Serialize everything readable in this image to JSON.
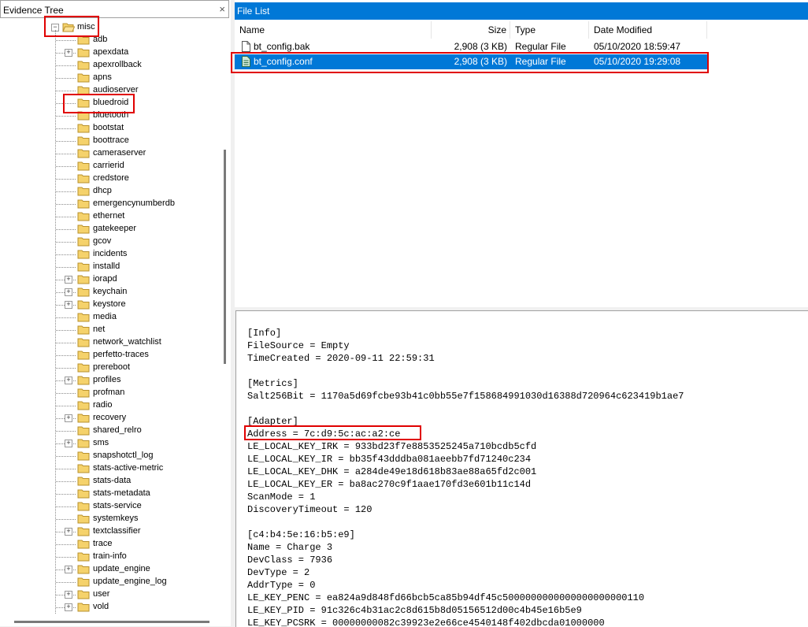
{
  "tree": {
    "title": "Evidence Tree",
    "close": "×",
    "root": "misc",
    "items": [
      {
        "label": "adb",
        "expandable": false
      },
      {
        "label": "apexdata",
        "expandable": true
      },
      {
        "label": "apexrollback",
        "expandable": false
      },
      {
        "label": "apns",
        "expandable": false
      },
      {
        "label": "audioserver",
        "expandable": false
      },
      {
        "label": "bluedroid",
        "expandable": false
      },
      {
        "label": "bluetooth",
        "expandable": false
      },
      {
        "label": "bootstat",
        "expandable": false
      },
      {
        "label": "boottrace",
        "expandable": false
      },
      {
        "label": "cameraserver",
        "expandable": false
      },
      {
        "label": "carrierid",
        "expandable": false
      },
      {
        "label": "credstore",
        "expandable": false
      },
      {
        "label": "dhcp",
        "expandable": false
      },
      {
        "label": "emergencynumberdb",
        "expandable": false
      },
      {
        "label": "ethernet",
        "expandable": false
      },
      {
        "label": "gatekeeper",
        "expandable": false
      },
      {
        "label": "gcov",
        "expandable": false
      },
      {
        "label": "incidents",
        "expandable": false
      },
      {
        "label": "installd",
        "expandable": false
      },
      {
        "label": "iorapd",
        "expandable": true
      },
      {
        "label": "keychain",
        "expandable": true
      },
      {
        "label": "keystore",
        "expandable": true
      },
      {
        "label": "media",
        "expandable": false
      },
      {
        "label": "net",
        "expandable": false
      },
      {
        "label": "network_watchlist",
        "expandable": false
      },
      {
        "label": "perfetto-traces",
        "expandable": false
      },
      {
        "label": "prereboot",
        "expandable": false
      },
      {
        "label": "profiles",
        "expandable": true
      },
      {
        "label": "profman",
        "expandable": false
      },
      {
        "label": "radio",
        "expandable": false
      },
      {
        "label": "recovery",
        "expandable": true
      },
      {
        "label": "shared_relro",
        "expandable": false
      },
      {
        "label": "sms",
        "expandable": true
      },
      {
        "label": "snapshotctl_log",
        "expandable": false
      },
      {
        "label": "stats-active-metric",
        "expandable": false
      },
      {
        "label": "stats-data",
        "expandable": false
      },
      {
        "label": "stats-metadata",
        "expandable": false
      },
      {
        "label": "stats-service",
        "expandable": false
      },
      {
        "label": "systemkeys",
        "expandable": false
      },
      {
        "label": "textclassifier",
        "expandable": true
      },
      {
        "label": "trace",
        "expandable": false
      },
      {
        "label": "train-info",
        "expandable": false
      },
      {
        "label": "update_engine",
        "expandable": true
      },
      {
        "label": "update_engine_log",
        "expandable": false
      },
      {
        "label": "user",
        "expandable": true
      },
      {
        "label": "vold",
        "expandable": true
      }
    ]
  },
  "file_list": {
    "title": "File List",
    "columns": {
      "name": "Name",
      "size": "Size",
      "type": "Type",
      "modified": "Date Modified"
    },
    "rows": [
      {
        "name": "bt_config.bak",
        "size": "2,908 (3 KB)",
        "type": "Regular File",
        "modified": "05/10/2020 18:59:47",
        "selected": false
      },
      {
        "name": "bt_config.conf",
        "size": "2,908 (3 KB)",
        "type": "Regular File",
        "modified": "05/10/2020 19:29:08",
        "selected": true
      }
    ]
  },
  "viewer": {
    "lines": [
      "[Info]",
      "FileSource = Empty",
      "TimeCreated = 2020-09-11 22:59:31",
      "",
      "[Metrics]",
      "Salt256Bit = 1170a5d69fcbe93b41c0bb55e7f158684991030d16388d720964c623419b1ae7",
      "",
      "[Adapter]",
      "Address = 7c:d9:5c:ac:a2:ce",
      "LE_LOCAL_KEY_IRK = 933bd23f7e8853525245a710bcdb5cfd",
      "LE_LOCAL_KEY_IR = bb35f43dddba081aeebb7fd71240c234",
      "LE_LOCAL_KEY_DHK = a284de49e18d618b83ae88a65fd2c001",
      "LE_LOCAL_KEY_ER = ba8ac270c9f1aae170fd3e601b11c14d",
      "ScanMode = 1",
      "DiscoveryTimeout = 120",
      "",
      "[c4:b4:5e:16:b5:e9]",
      "Name = Charge 3",
      "DevClass = 7936",
      "DevType = 2",
      "AddrType = 0",
      "LE_KEY_PENC = ea824a9d848fd66bcb5ca85b94df45c5000000000000000000000110",
      "LE_KEY_PID = 91c326c4b31ac2c8d615b8d05156512d00c4b45e16b5e9",
      "LE_KEY_PCSRK = 00000000082c39923e2e66ce4540148f402dbcda01000000"
    ]
  },
  "colors": {
    "selection": "#0078d7",
    "highlight": "#e00000",
    "folder": "#f5d26b"
  }
}
